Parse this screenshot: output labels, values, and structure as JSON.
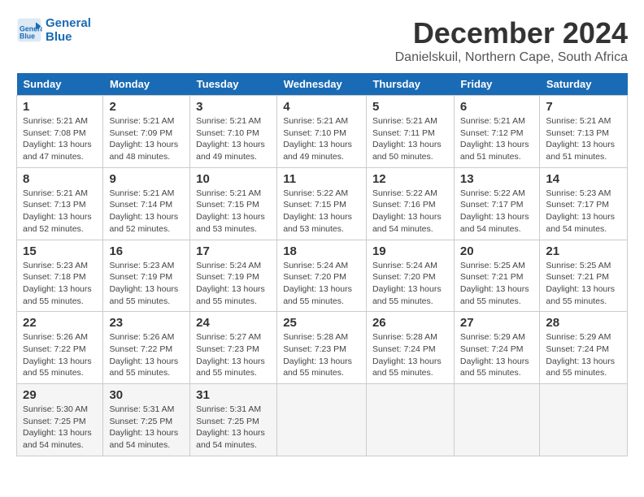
{
  "logo": {
    "line1": "General",
    "line2": "Blue"
  },
  "title": "December 2024",
  "location": "Danielskuil, Northern Cape, South Africa",
  "days_of_week": [
    "Sunday",
    "Monday",
    "Tuesday",
    "Wednesday",
    "Thursday",
    "Friday",
    "Saturday"
  ],
  "weeks": [
    [
      {
        "num": "1",
        "sunrise": "5:21 AM",
        "sunset": "7:08 PM",
        "daylight": "13 hours and 47 minutes."
      },
      {
        "num": "2",
        "sunrise": "5:21 AM",
        "sunset": "7:09 PM",
        "daylight": "13 hours and 48 minutes."
      },
      {
        "num": "3",
        "sunrise": "5:21 AM",
        "sunset": "7:10 PM",
        "daylight": "13 hours and 49 minutes."
      },
      {
        "num": "4",
        "sunrise": "5:21 AM",
        "sunset": "7:10 PM",
        "daylight": "13 hours and 49 minutes."
      },
      {
        "num": "5",
        "sunrise": "5:21 AM",
        "sunset": "7:11 PM",
        "daylight": "13 hours and 50 minutes."
      },
      {
        "num": "6",
        "sunrise": "5:21 AM",
        "sunset": "7:12 PM",
        "daylight": "13 hours and 51 minutes."
      },
      {
        "num": "7",
        "sunrise": "5:21 AM",
        "sunset": "7:13 PM",
        "daylight": "13 hours and 51 minutes."
      }
    ],
    [
      {
        "num": "8",
        "sunrise": "5:21 AM",
        "sunset": "7:13 PM",
        "daylight": "13 hours and 52 minutes."
      },
      {
        "num": "9",
        "sunrise": "5:21 AM",
        "sunset": "7:14 PM",
        "daylight": "13 hours and 52 minutes."
      },
      {
        "num": "10",
        "sunrise": "5:21 AM",
        "sunset": "7:15 PM",
        "daylight": "13 hours and 53 minutes."
      },
      {
        "num": "11",
        "sunrise": "5:22 AM",
        "sunset": "7:15 PM",
        "daylight": "13 hours and 53 minutes."
      },
      {
        "num": "12",
        "sunrise": "5:22 AM",
        "sunset": "7:16 PM",
        "daylight": "13 hours and 54 minutes."
      },
      {
        "num": "13",
        "sunrise": "5:22 AM",
        "sunset": "7:17 PM",
        "daylight": "13 hours and 54 minutes."
      },
      {
        "num": "14",
        "sunrise": "5:23 AM",
        "sunset": "7:17 PM",
        "daylight": "13 hours and 54 minutes."
      }
    ],
    [
      {
        "num": "15",
        "sunrise": "5:23 AM",
        "sunset": "7:18 PM",
        "daylight": "13 hours and 55 minutes."
      },
      {
        "num": "16",
        "sunrise": "5:23 AM",
        "sunset": "7:19 PM",
        "daylight": "13 hours and 55 minutes."
      },
      {
        "num": "17",
        "sunrise": "5:24 AM",
        "sunset": "7:19 PM",
        "daylight": "13 hours and 55 minutes."
      },
      {
        "num": "18",
        "sunrise": "5:24 AM",
        "sunset": "7:20 PM",
        "daylight": "13 hours and 55 minutes."
      },
      {
        "num": "19",
        "sunrise": "5:24 AM",
        "sunset": "7:20 PM",
        "daylight": "13 hours and 55 minutes."
      },
      {
        "num": "20",
        "sunrise": "5:25 AM",
        "sunset": "7:21 PM",
        "daylight": "13 hours and 55 minutes."
      },
      {
        "num": "21",
        "sunrise": "5:25 AM",
        "sunset": "7:21 PM",
        "daylight": "13 hours and 55 minutes."
      }
    ],
    [
      {
        "num": "22",
        "sunrise": "5:26 AM",
        "sunset": "7:22 PM",
        "daylight": "13 hours and 55 minutes."
      },
      {
        "num": "23",
        "sunrise": "5:26 AM",
        "sunset": "7:22 PM",
        "daylight": "13 hours and 55 minutes."
      },
      {
        "num": "24",
        "sunrise": "5:27 AM",
        "sunset": "7:23 PM",
        "daylight": "13 hours and 55 minutes."
      },
      {
        "num": "25",
        "sunrise": "5:28 AM",
        "sunset": "7:23 PM",
        "daylight": "13 hours and 55 minutes."
      },
      {
        "num": "26",
        "sunrise": "5:28 AM",
        "sunset": "7:24 PM",
        "daylight": "13 hours and 55 minutes."
      },
      {
        "num": "27",
        "sunrise": "5:29 AM",
        "sunset": "7:24 PM",
        "daylight": "13 hours and 55 minutes."
      },
      {
        "num": "28",
        "sunrise": "5:29 AM",
        "sunset": "7:24 PM",
        "daylight": "13 hours and 55 minutes."
      }
    ],
    [
      {
        "num": "29",
        "sunrise": "5:30 AM",
        "sunset": "7:25 PM",
        "daylight": "13 hours and 54 minutes."
      },
      {
        "num": "30",
        "sunrise": "5:31 AM",
        "sunset": "7:25 PM",
        "daylight": "13 hours and 54 minutes."
      },
      {
        "num": "31",
        "sunrise": "5:31 AM",
        "sunset": "7:25 PM",
        "daylight": "13 hours and 54 minutes."
      },
      null,
      null,
      null,
      null
    ]
  ]
}
